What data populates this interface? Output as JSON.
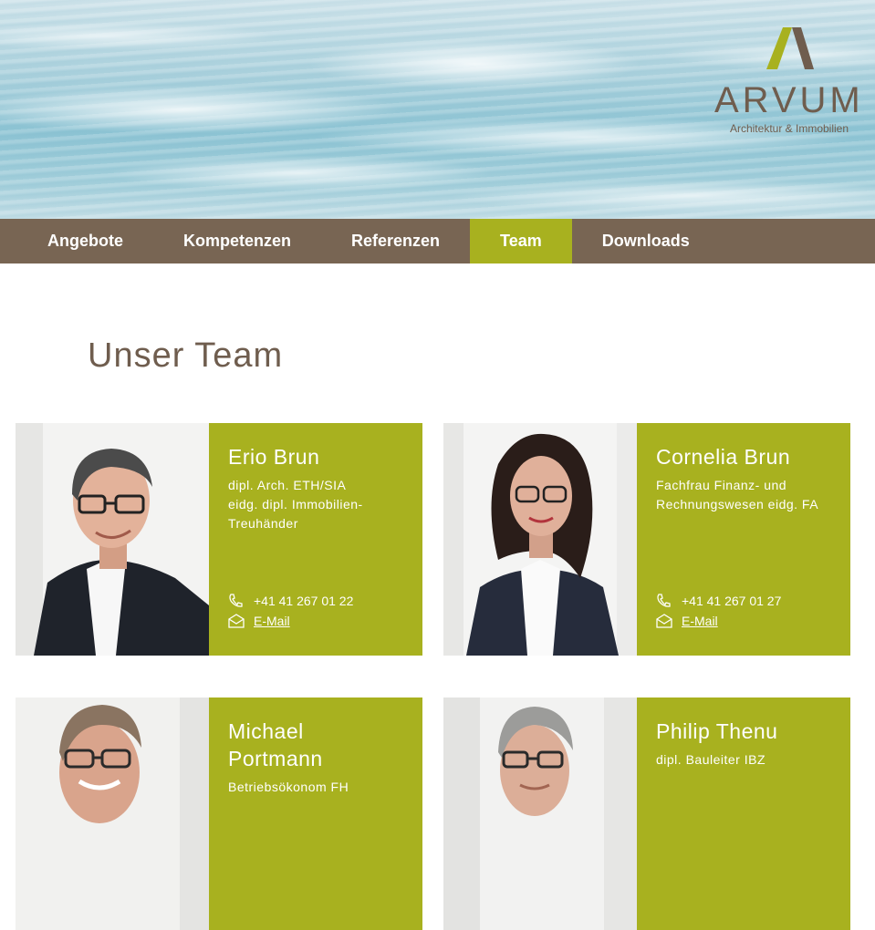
{
  "brand": {
    "name": "ARVUM",
    "tagline": "Architektur & Immobilien",
    "colors": {
      "brown": "#786553",
      "olive": "#a8b11f",
      "logo_green": "#a8b11f",
      "logo_brown": "#6f5d4e"
    }
  },
  "nav": {
    "items": [
      {
        "label": "Angebote",
        "active": false
      },
      {
        "label": "Kompetenzen",
        "active": false
      },
      {
        "label": "Referenzen",
        "active": false
      },
      {
        "label": "Team",
        "active": true
      },
      {
        "label": "Downloads",
        "active": false
      }
    ]
  },
  "page": {
    "title": "Unser Team"
  },
  "team": [
    {
      "name": "Erio Brun",
      "roles": [
        "dipl. Arch. ETH/SIA",
        "eidg. dipl. Immobilien-",
        "Treuhänder"
      ],
      "phone": "+41 41 267 01 22",
      "email_label": "E-Mail",
      "photo": "portrait-man-glasses"
    },
    {
      "name": "Cornelia Brun",
      "roles": [
        "Fachfrau Finanz- und",
        "Rechnungswesen eidg. FA"
      ],
      "phone": "+41 41 267 01 27",
      "email_label": "E-Mail",
      "photo": "portrait-woman-glasses"
    },
    {
      "name": "Michael Portmann",
      "roles": [
        "Betriebsökonom FH"
      ],
      "phone": "",
      "email_label": "",
      "photo": "portrait-man-glasses-smiling"
    },
    {
      "name": "Philip Thenu",
      "roles": [
        "dipl. Bauleiter IBZ"
      ],
      "phone": "",
      "email_label": "",
      "photo": "portrait-man-grey-hair"
    }
  ]
}
